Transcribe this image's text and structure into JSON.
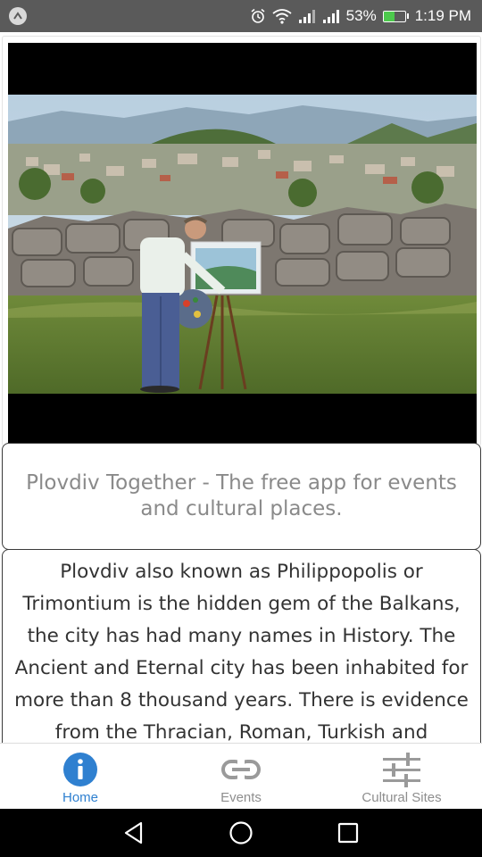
{
  "status_bar": {
    "battery_percent": "53%",
    "battery_level": 0.53,
    "time": "1:19 PM",
    "battery_fill_color": "#4cc94c",
    "icons": [
      "notification-icon",
      "alarm-icon",
      "wifi-icon",
      "signal-icon",
      "signal-icon",
      "battery-charging-icon"
    ]
  },
  "video": {
    "label": "video-player"
  },
  "tagline": "Plovdiv Together - The free app for events and cultural places.",
  "description": "Plovdiv also known as Philippopolis or Trimontium is the hidden gem of the Balkans, the city has had many names in History. The Ancient and Eternal city has been inhabited for more than 8 thousand years. There is evidence from the Thracian, Roman, Turkish and Bulgarian",
  "tabs": [
    {
      "label": "Home",
      "icon": "info-icon",
      "active": true
    },
    {
      "label": "Events",
      "icon": "link-icon",
      "active": false
    },
    {
      "label": "Cultural Sites",
      "icon": "sliders-icon",
      "active": false
    }
  ],
  "colors": {
    "accent": "#2f80d0",
    "inactive": "#8e8e8e",
    "status_bar": "#5a5a5a"
  },
  "nav_bar": {
    "buttons": [
      "back-icon",
      "home-icon",
      "recents-icon"
    ]
  }
}
